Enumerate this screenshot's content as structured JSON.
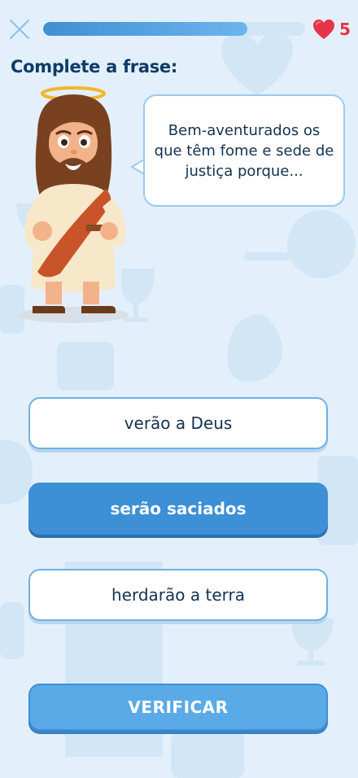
{
  "header": {
    "close_icon": "close-icon",
    "progress_fraction": 0.78,
    "lives_icon": "heart-icon",
    "lives_count": "5",
    "lives_color": "#e5334a"
  },
  "prompt": {
    "title": "Complete a frase:"
  },
  "character": {
    "icon": "jesus-character-illustration"
  },
  "speech_bubble": {
    "text": "Bem-aventurados os que têm fome e sede de justiça porque..."
  },
  "options": [
    {
      "label": "verão a Deus",
      "selected": false
    },
    {
      "label": "serão saciados",
      "selected": true
    },
    {
      "label": "herdarão a terra",
      "selected": false
    }
  ],
  "verify_button": {
    "label": "VERIFICAR"
  },
  "colors": {
    "background": "#e3f0fb",
    "accent": "#3d8fd6",
    "title_text": "#0d3b66"
  }
}
